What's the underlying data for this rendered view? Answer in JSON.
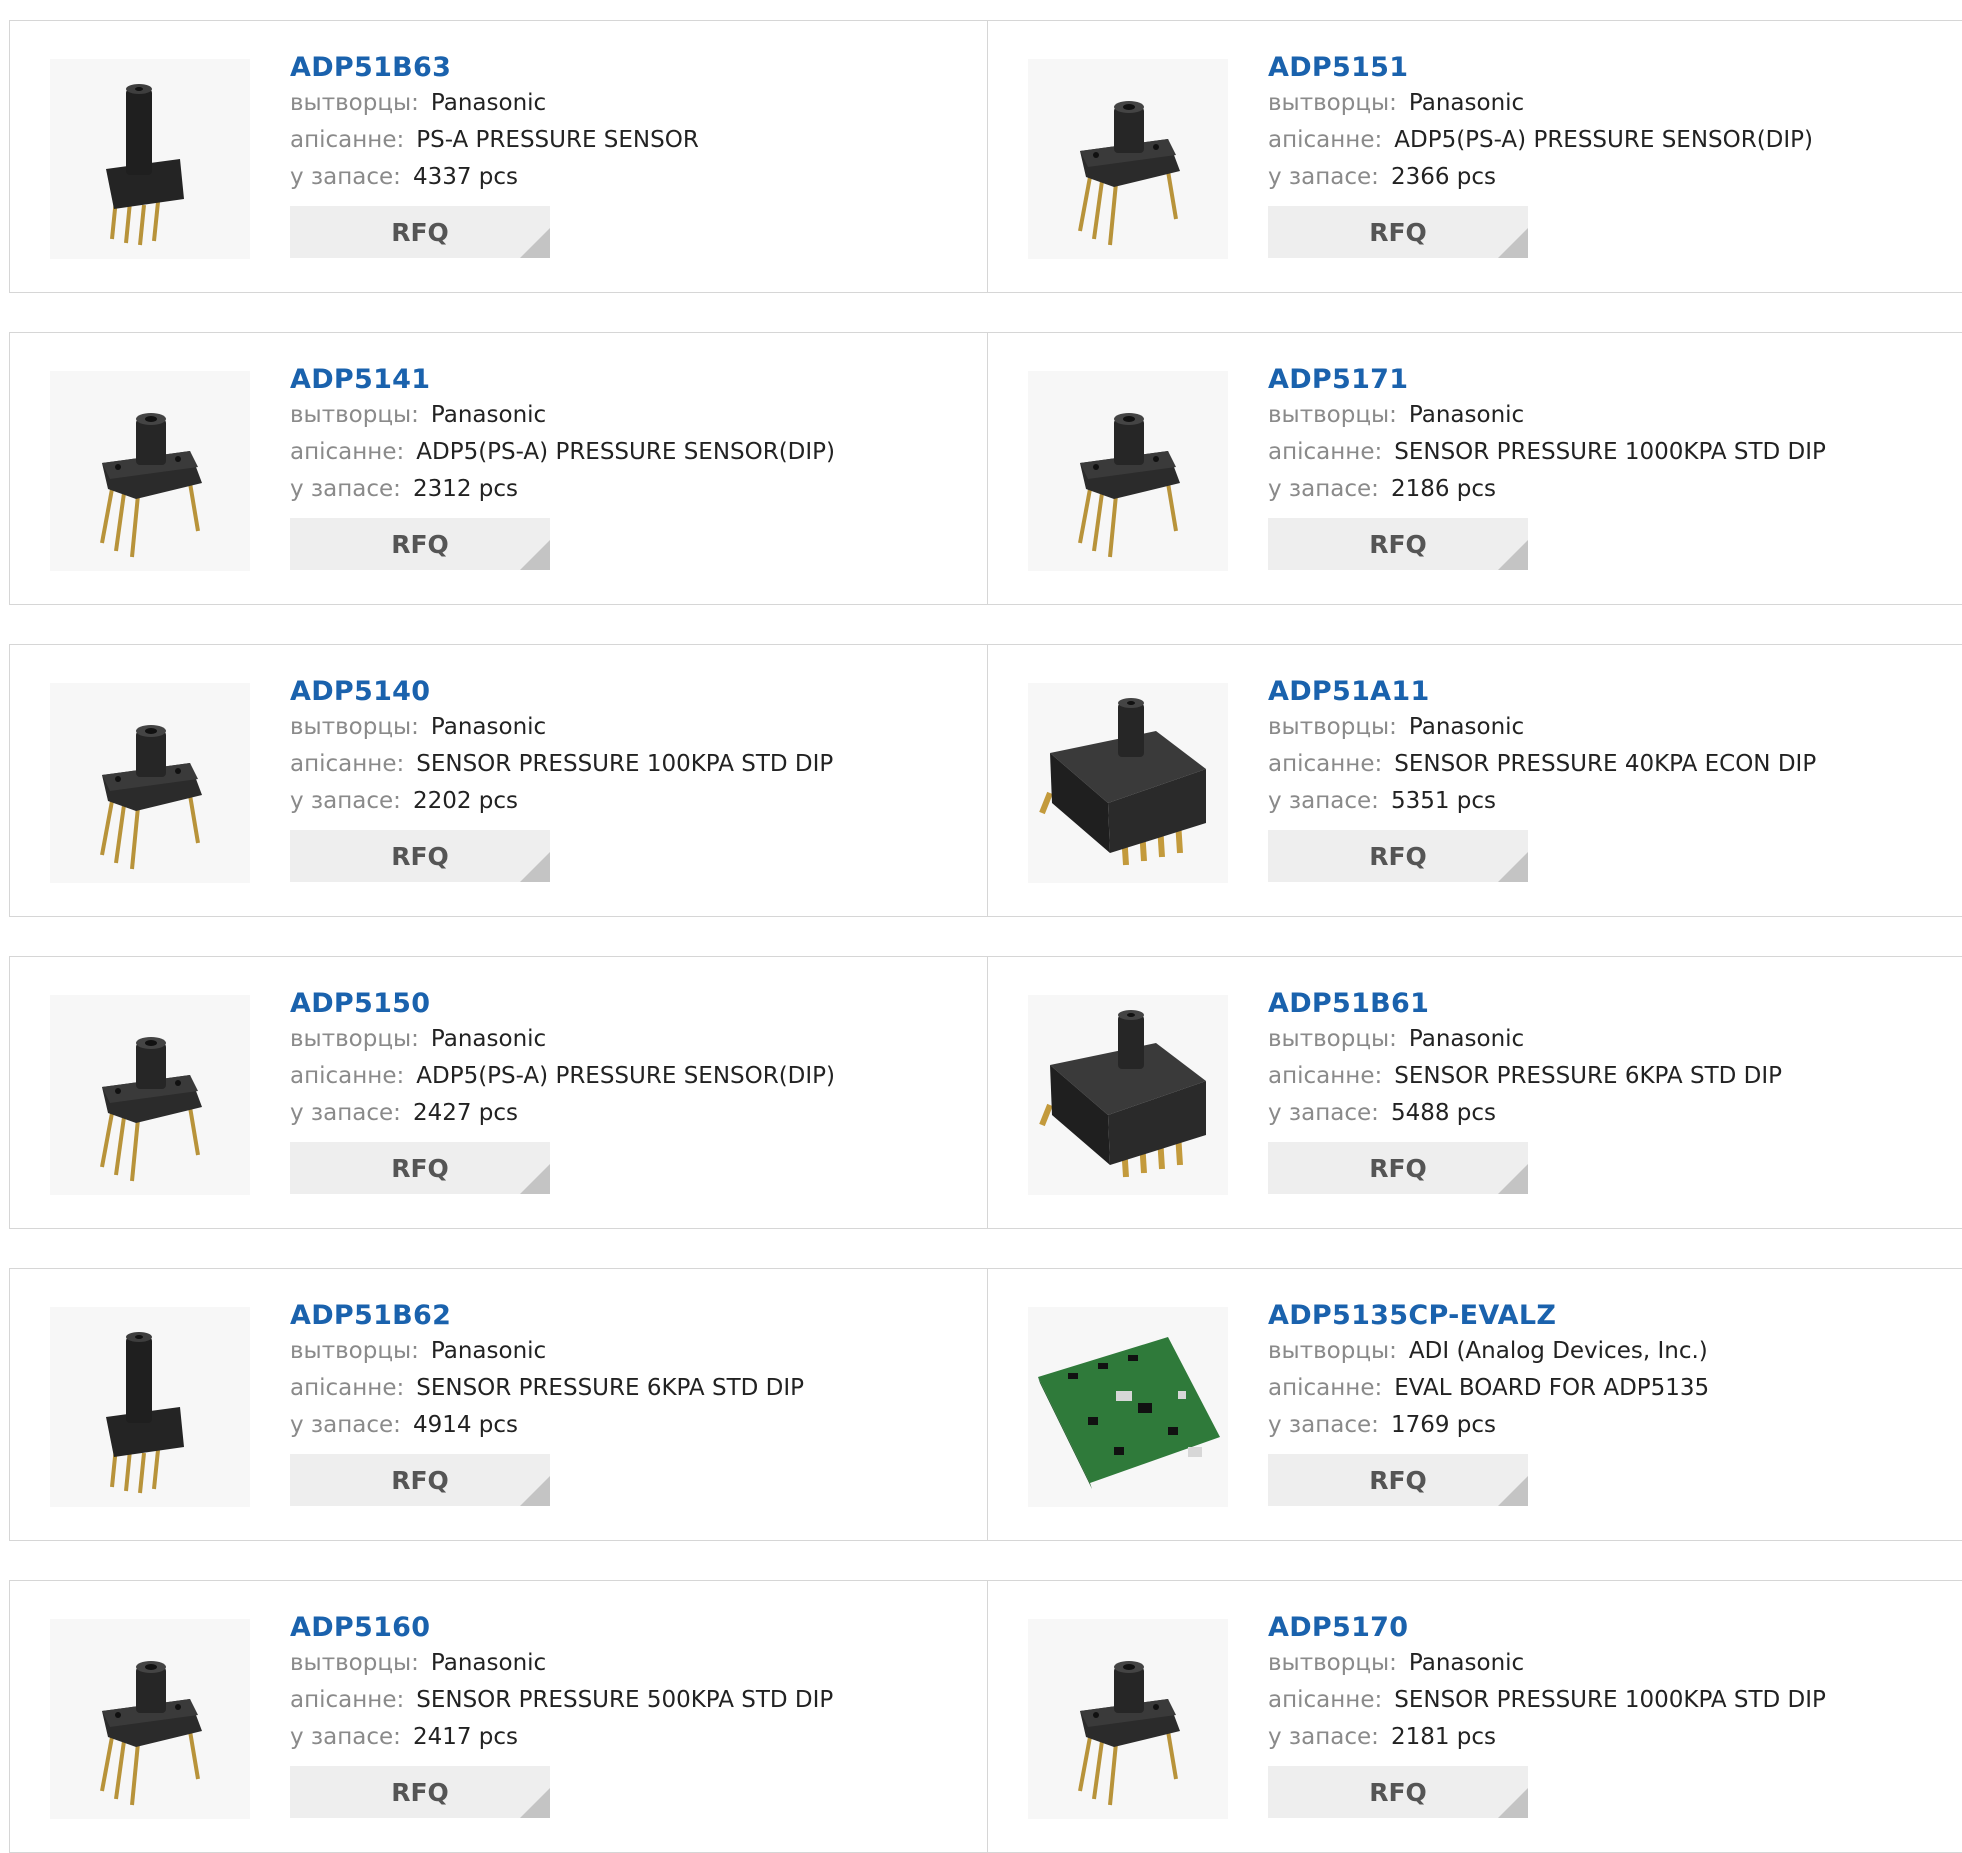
{
  "labels": {
    "manufacturer": "вытворцы:",
    "description": "апісанне:",
    "stock": "у запасе:",
    "rfq": "RFQ"
  },
  "colors": {
    "title_link": "#1a62ad",
    "label": "#8a8a8a",
    "rfq_bg": "#eeeeee",
    "border": "#d6d6d6"
  },
  "products": [
    {
      "part": "ADP51B63",
      "manufacturer": "Panasonic",
      "description": "PS-A PRESSURE SENSOR",
      "stock": "4337 pcs",
      "image": "tall-tube-sensor-icon"
    },
    {
      "part": "ADP5151",
      "manufacturer": "Panasonic",
      "description": "ADP5(PS-A) PRESSURE SENSOR(DIP)",
      "stock": "2366 pcs",
      "image": "dip-pressure-sensor-icon"
    },
    {
      "part": "ADP5141",
      "manufacturer": "Panasonic",
      "description": "ADP5(PS-A) PRESSURE SENSOR(DIP)",
      "stock": "2312 pcs",
      "image": "dip-pressure-sensor-icon"
    },
    {
      "part": "ADP5171",
      "manufacturer": "Panasonic",
      "description": "SENSOR PRESSURE 1000KPA STD DIP",
      "stock": "2186 pcs",
      "image": "dip-pressure-sensor-icon"
    },
    {
      "part": "ADP5140",
      "manufacturer": "Panasonic",
      "description": "SENSOR PRESSURE 100KPA STD DIP",
      "stock": "2202 pcs",
      "image": "dip-pressure-sensor-icon"
    },
    {
      "part": "ADP51A11",
      "manufacturer": "Panasonic",
      "description": "SENSOR PRESSURE 40KPA ECON DIP",
      "stock": "5351 pcs",
      "image": "large-block-sensor-icon"
    },
    {
      "part": "ADP5150",
      "manufacturer": "Panasonic",
      "description": "ADP5(PS-A) PRESSURE SENSOR(DIP)",
      "stock": "2427 pcs",
      "image": "dip-pressure-sensor-icon"
    },
    {
      "part": "ADP51B61",
      "manufacturer": "Panasonic",
      "description": "SENSOR PRESSURE 6KPA STD DIP",
      "stock": "5488 pcs",
      "image": "large-block-sensor-icon"
    },
    {
      "part": "ADP51B62",
      "manufacturer": "Panasonic",
      "description": "SENSOR PRESSURE 6KPA STD DIP",
      "stock": "4914 pcs",
      "image": "tall-tube-sensor-icon"
    },
    {
      "part": "ADP5135CP-EVALZ",
      "manufacturer": "ADI (Analog Devices, Inc.)",
      "description": "EVAL BOARD FOR ADP5135",
      "stock": "1769 pcs",
      "image": "eval-board-icon"
    },
    {
      "part": "ADP5160",
      "manufacturer": "Panasonic",
      "description": "SENSOR PRESSURE 500KPA STD DIP",
      "stock": "2417 pcs",
      "image": "dip-pressure-sensor-icon"
    },
    {
      "part": "ADP5170",
      "manufacturer": "Panasonic",
      "description": "SENSOR PRESSURE 1000KPA STD DIP",
      "stock": "2181 pcs",
      "image": "dip-pressure-sensor-icon"
    }
  ]
}
